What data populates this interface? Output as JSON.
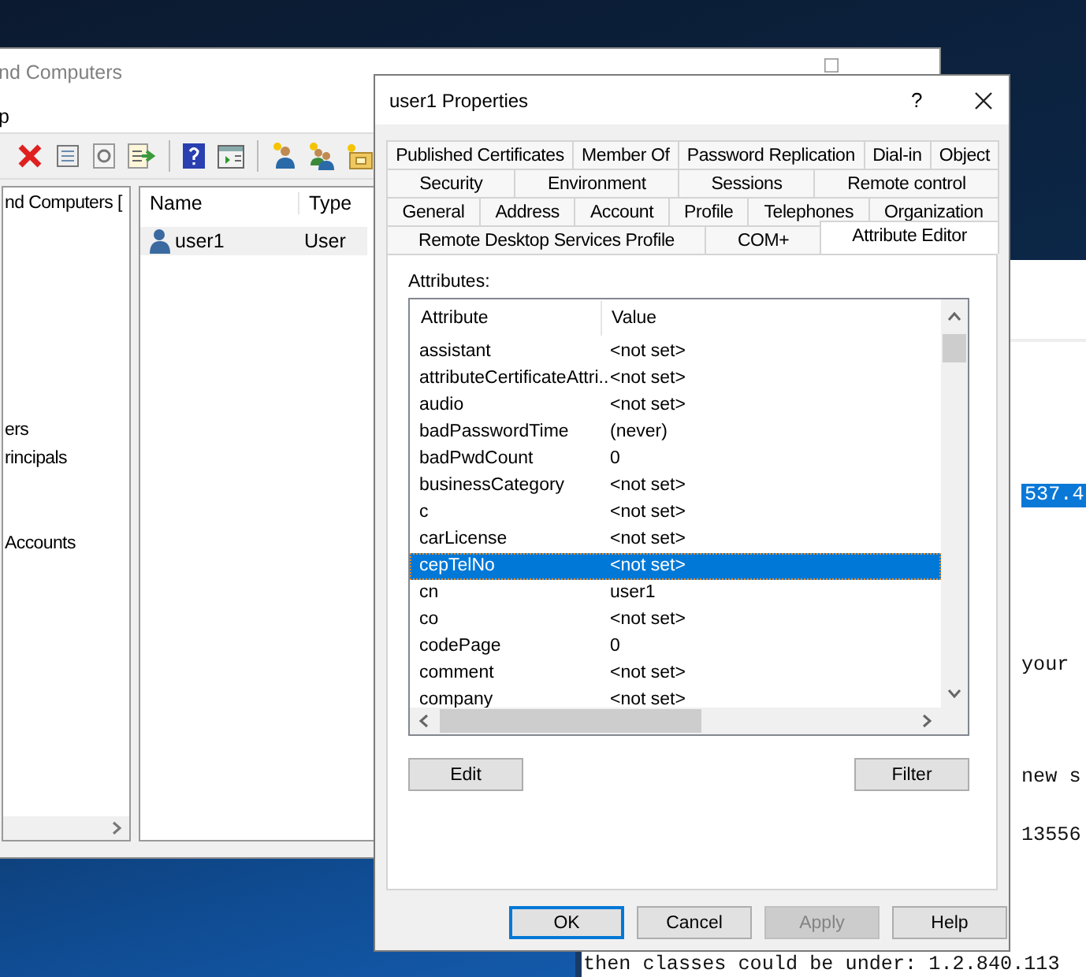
{
  "back_window": {
    "title": "nd Computers",
    "menu": [
      {
        "label": "p"
      }
    ],
    "tree": [
      {
        "label": "nd Computers ["
      },
      {
        "label": "ers"
      },
      {
        "label": "rincipals"
      },
      {
        "label": "Accounts"
      }
    ],
    "list": {
      "columns": [
        "Name",
        "Type"
      ],
      "rows": [
        {
          "name": "user1",
          "type": "User",
          "selected": true
        }
      ]
    }
  },
  "console": {
    "lines": [
      {
        "text": "537.4",
        "highlighted": true
      },
      {
        "text": "your",
        "highlighted": false
      },
      {
        "text": "new s",
        "highlighted": false
      },
      {
        "text": "13556",
        "highlighted": false
      },
      {
        "text": "then classes could be under: 1.2.840.113",
        "highlighted": false
      }
    ]
  },
  "dialog": {
    "title": "user1 Properties",
    "help": "?",
    "tab_rows": [
      {
        "tabs": [
          {
            "label": "Published Certificates",
            "selected": false
          },
          {
            "label": "Member Of",
            "selected": false
          },
          {
            "label": "Password Replication",
            "selected": false
          },
          {
            "label": "Dial-in",
            "selected": false
          },
          {
            "label": "Object",
            "selected": false
          }
        ]
      },
      {
        "tabs": [
          {
            "label": "Security",
            "selected": false
          },
          {
            "label": "Environment",
            "selected": false
          },
          {
            "label": "Sessions",
            "selected": false
          },
          {
            "label": "Remote control",
            "selected": false
          }
        ]
      },
      {
        "tabs": [
          {
            "label": "General",
            "selected": false
          },
          {
            "label": "Address",
            "selected": false
          },
          {
            "label": "Account",
            "selected": false
          },
          {
            "label": "Profile",
            "selected": false
          },
          {
            "label": "Telephones",
            "selected": false
          },
          {
            "label": "Organization",
            "selected": false
          }
        ]
      },
      {
        "tabs": [
          {
            "label": "Remote Desktop Services Profile",
            "selected": false
          },
          {
            "label": "COM+",
            "selected": false
          },
          {
            "label": "Attribute Editor",
            "selected": true
          }
        ]
      }
    ],
    "attributes_label": "Attributes:",
    "columns": [
      "Attribute",
      "Value"
    ],
    "rows": [
      {
        "attribute": "assistant",
        "value": "<not set>",
        "selected": false
      },
      {
        "attribute": "attributeCertificateAttri...",
        "value": "<not set>",
        "selected": false
      },
      {
        "attribute": "audio",
        "value": "<not set>",
        "selected": false
      },
      {
        "attribute": "badPasswordTime",
        "value": "(never)",
        "selected": false
      },
      {
        "attribute": "badPwdCount",
        "value": "0",
        "selected": false
      },
      {
        "attribute": "businessCategory",
        "value": "<not set>",
        "selected": false
      },
      {
        "attribute": "c",
        "value": "<not set>",
        "selected": false
      },
      {
        "attribute": "carLicense",
        "value": "<not set>",
        "selected": false
      },
      {
        "attribute": "cepTelNo",
        "value": "<not set>",
        "selected": true
      },
      {
        "attribute": "cn",
        "value": "user1",
        "selected": false
      },
      {
        "attribute": "co",
        "value": "<not set>",
        "selected": false
      },
      {
        "attribute": "codePage",
        "value": "0",
        "selected": false
      },
      {
        "attribute": "comment",
        "value": "<not set>",
        "selected": false
      },
      {
        "attribute": "company",
        "value": "<not set>",
        "selected": false
      }
    ],
    "edit_button": "Edit",
    "filter_button": "Filter",
    "buttons": [
      {
        "label": "OK",
        "default": true,
        "disabled": false
      },
      {
        "label": "Cancel",
        "default": false,
        "disabled": false
      },
      {
        "label": "Apply",
        "default": false,
        "disabled": true
      },
      {
        "label": "Help",
        "default": false,
        "disabled": false
      }
    ]
  }
}
